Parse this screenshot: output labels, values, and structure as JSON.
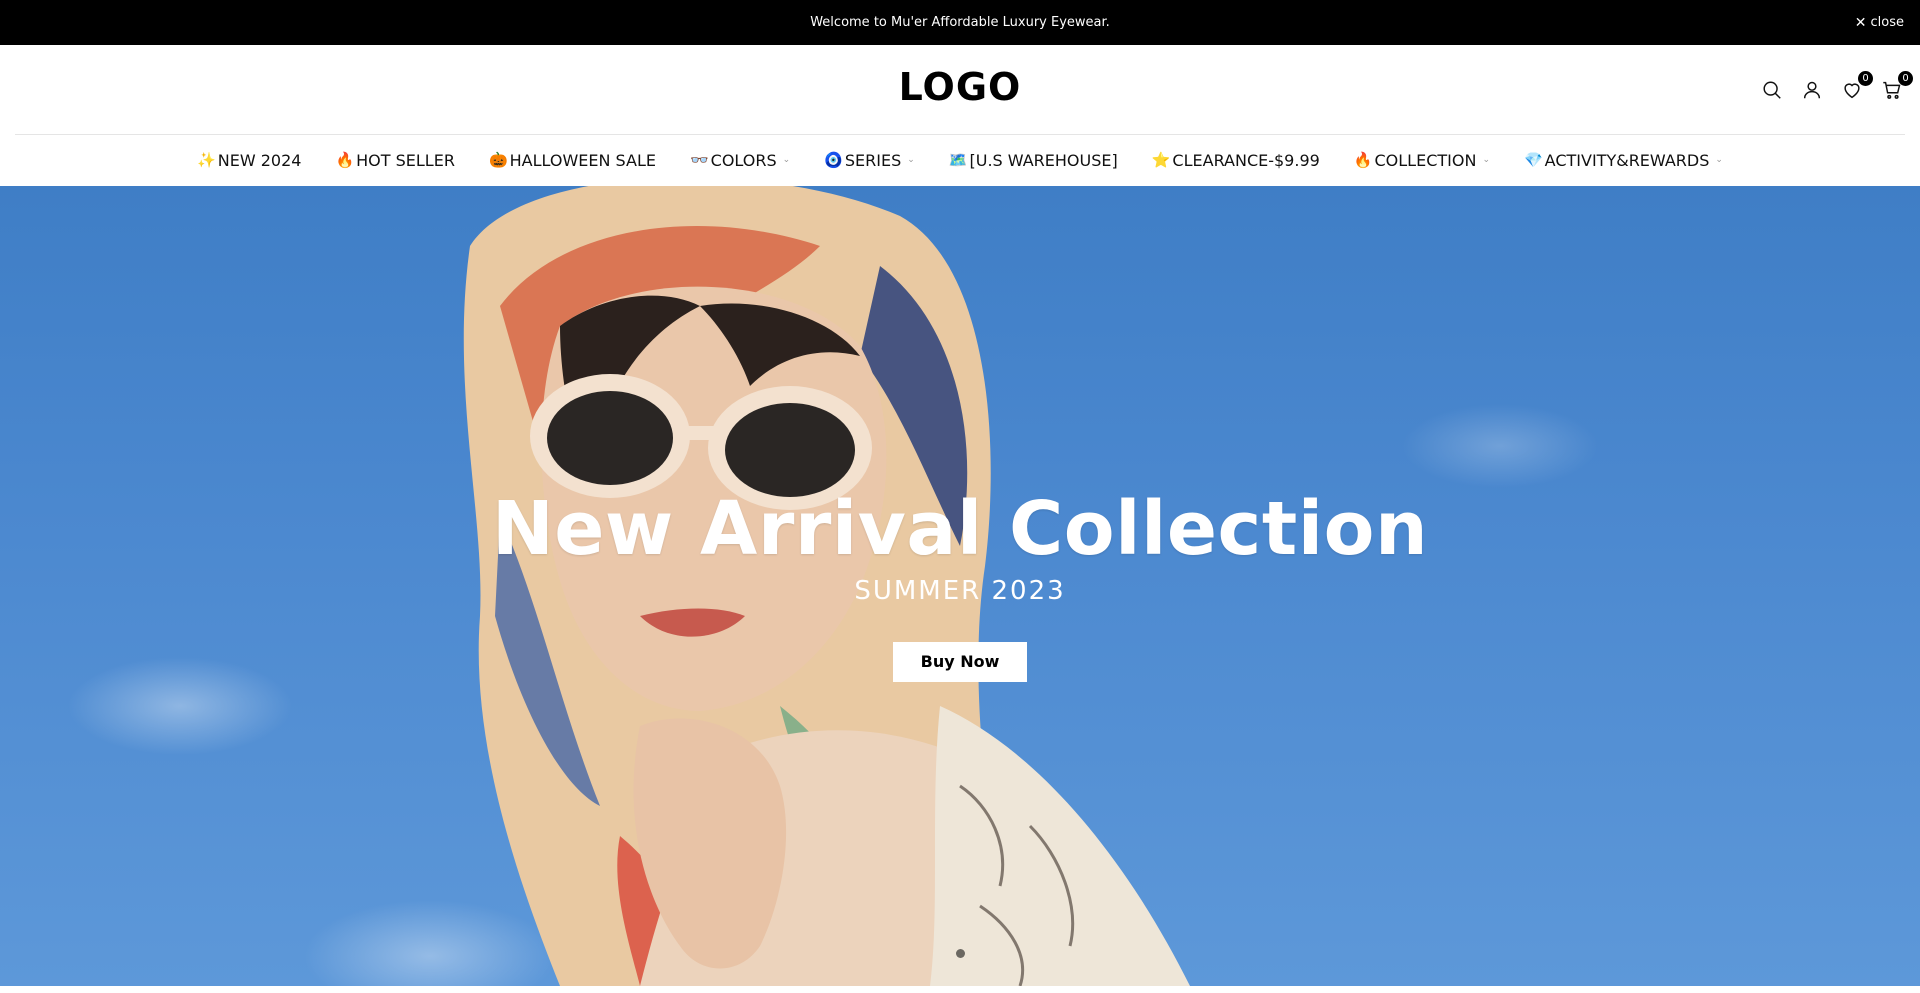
{
  "announcement": {
    "text": "Welcome to Mu'er Affordable Luxury Eyewear.",
    "close_label": "close",
    "close_icon": "x-icon"
  },
  "header": {
    "logo": "LOGO",
    "wishlist_count": "0",
    "cart_count": "0",
    "icons": [
      "search-icon",
      "user-icon",
      "heart-icon",
      "cart-icon"
    ]
  },
  "nav": {
    "items": [
      {
        "emoji": "✨",
        "label": "NEW 2024",
        "has_dropdown": false
      },
      {
        "emoji": "🔥",
        "label": "HOT SELLER",
        "has_dropdown": false
      },
      {
        "emoji": "🎃",
        "label": "HALLOWEEN SALE",
        "has_dropdown": false
      },
      {
        "emoji": "👓",
        "label": "COLORS",
        "has_dropdown": true
      },
      {
        "emoji": "🧿",
        "label": "SERIES",
        "has_dropdown": true
      },
      {
        "emoji": "🗺️",
        "label": " [U.S WAREHOUSE]",
        "has_dropdown": false
      },
      {
        "emoji": "⭐",
        "label": "CLEARANCE-$9.99",
        "has_dropdown": false
      },
      {
        "emoji": "🔥",
        "label": "COLLECTION",
        "has_dropdown": true
      },
      {
        "emoji": "💎",
        "label": "ACTIVITY&REWARDS",
        "has_dropdown": true
      }
    ]
  },
  "hero": {
    "title": "New Arrival Collection",
    "subtitle": "SUMMER 2023",
    "button_label": "Buy Now",
    "slide_count": 1,
    "active_slide": 1
  },
  "colors": {
    "announce_bg": "#000000",
    "sky": "#4b88cf",
    "button_bg": "#ffffff"
  }
}
